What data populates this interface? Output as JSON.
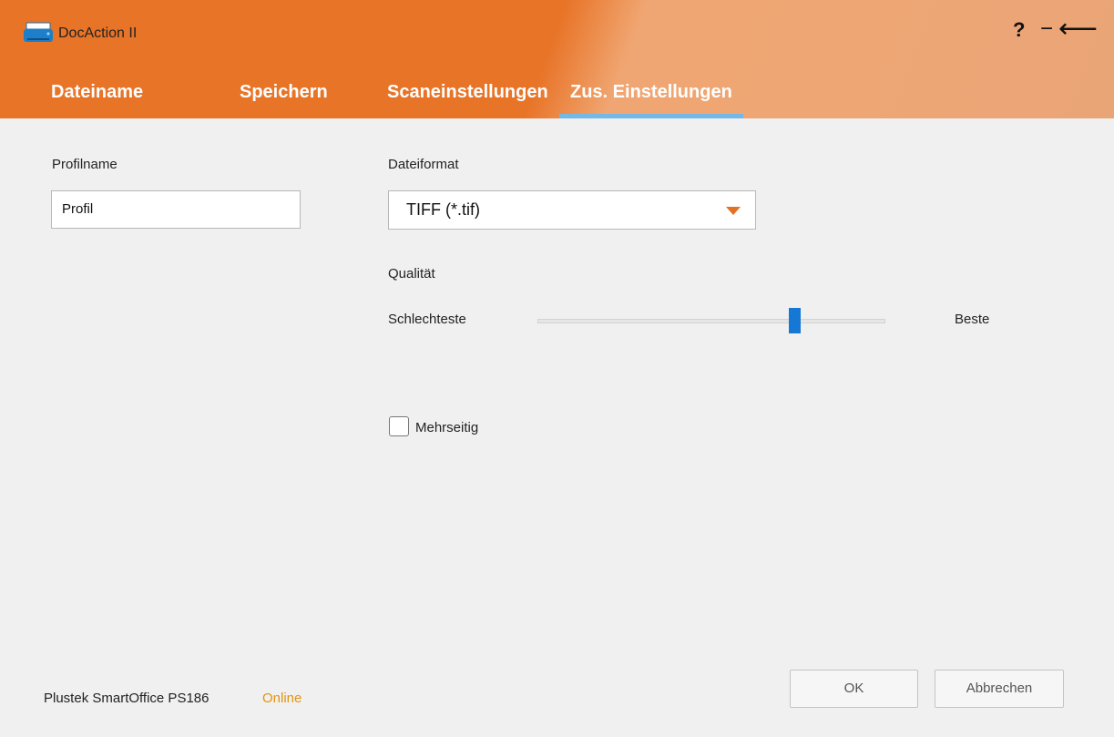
{
  "app": {
    "title": "DocAction II"
  },
  "window": {
    "help": "?",
    "minimize": "−",
    "back": "⟵"
  },
  "tabs": [
    {
      "label": "Dateiname"
    },
    {
      "label": "Speichern"
    },
    {
      "label": "Scaneinstellungen"
    },
    {
      "label": "Zus. Einstellungen",
      "active": true
    }
  ],
  "profile": {
    "label": "Profilname",
    "value": "Profil"
  },
  "format": {
    "label": "Dateiformat",
    "selected": "TIFF (*.tif)"
  },
  "quality": {
    "label": "Qualität",
    "min_label": "Schlechteste",
    "max_label": "Beste",
    "value_fraction": 0.73
  },
  "multipage": {
    "label": "Mehrseitig",
    "checked": false
  },
  "buttons": {
    "ok": "OK",
    "cancel": "Abbrechen"
  },
  "status": {
    "device": "Plustek SmartOffice PS186",
    "state": "Online"
  },
  "colors": {
    "header_orange": "#e87428",
    "accent_blue": "#1478d4",
    "online_text": "#e5930e"
  }
}
